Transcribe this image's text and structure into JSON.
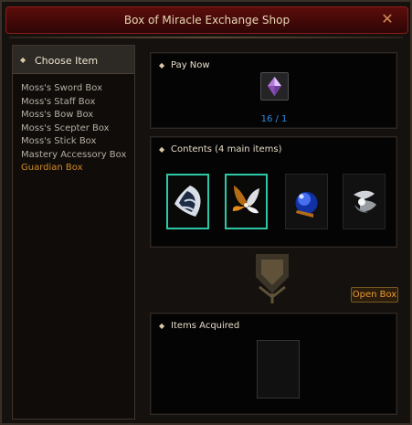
{
  "window": {
    "title": "Box of Miracle Exchange Shop",
    "close_icon": "close-icon"
  },
  "left": {
    "header": "Choose Item",
    "items": [
      {
        "label": "Moss's Sword Box",
        "active": false
      },
      {
        "label": "Moss's Staff Box",
        "active": false
      },
      {
        "label": "Moss's Bow Box",
        "active": false
      },
      {
        "label": "Moss's Scepter Box",
        "active": false
      },
      {
        "label": "Moss's Stick Box",
        "active": false
      },
      {
        "label": "Mastery Accessory Box",
        "active": false
      },
      {
        "label": "Guardian Box",
        "active": true
      }
    ]
  },
  "pay": {
    "title": "Pay Now",
    "count": "16 / 1",
    "icon": "jewel-icon"
  },
  "contents": {
    "title": "Contents (4 main items)",
    "slots": [
      {
        "icon": "dark-wing-icon",
        "selected": true
      },
      {
        "icon": "golden-wing-icon",
        "selected": true
      },
      {
        "icon": "blue-orb-icon",
        "selected": false
      },
      {
        "icon": "silver-crest-icon",
        "selected": false
      }
    ]
  },
  "buttons": {
    "open_box": "Open Box"
  },
  "acquired": {
    "title": "Items Acquired",
    "icon": "empty-slot-icon"
  },
  "colors": {
    "accent": "#2cc8a5",
    "active_item": "#d58a24",
    "count": "#2f8ce0"
  }
}
